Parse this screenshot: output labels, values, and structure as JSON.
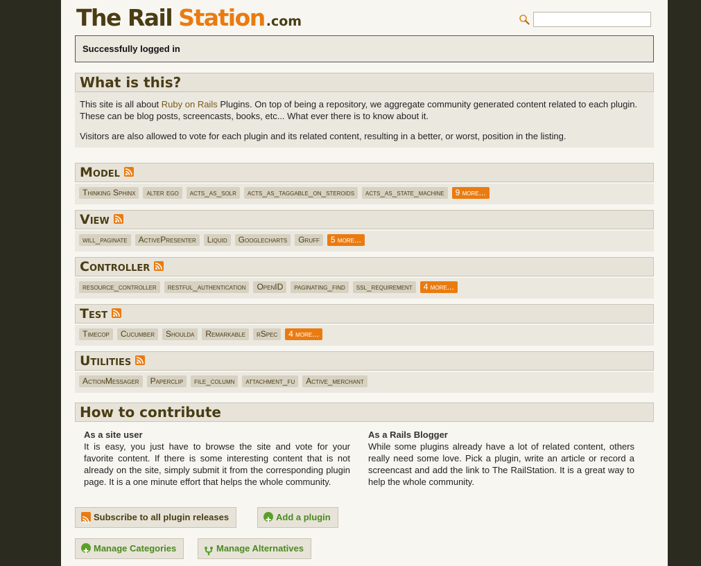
{
  "header": {
    "logo_part1": "The Rail",
    "logo_part2": "Station",
    "logo_part3": ".com",
    "search": {
      "value": "",
      "placeholder": ""
    }
  },
  "flash": "Successfully logged in",
  "intro": {
    "title": "What is this?",
    "p1_before": "This site is all about ",
    "p1_link": "Ruby on Rails",
    "p1_after": " Plugins. On top of being a repository, we aggregate community generated content related to each plugin. These can be blog posts, screencasts, books, etc... What ever there is to know about it.",
    "p2": "Visitors are also allowed to vote for each plugin and its related content, resulting in a better, or worst, position in the listing."
  },
  "categories": [
    {
      "title": "Model",
      "tags": [
        "Thinking Sphinx",
        "alter ego",
        "acts_as_solr",
        "acts_as_taggable_on_steroids",
        "acts_as_state_machine"
      ],
      "more": "9 more..."
    },
    {
      "title": "View",
      "tags": [
        "will_paginate",
        "ActivePresenter",
        "Liquid",
        "Googlecharts",
        "Gruff"
      ],
      "more": "5 more..."
    },
    {
      "title": "Controller",
      "tags": [
        "resource_controller",
        "restful_authentication",
        "OpenID",
        "paginating_find",
        "ssl_requirement"
      ],
      "more": "4 more..."
    },
    {
      "title": "Test",
      "tags": [
        "Timecop",
        "Cucumber",
        "Shoulda",
        "Remarkable",
        "rSpec"
      ],
      "more": "4 more..."
    },
    {
      "title": "Utilities",
      "tags": [
        "ActionMessager",
        "Paperclip",
        "file_column",
        "attachment_fu",
        "Active_merchant"
      ],
      "more": ""
    }
  ],
  "contribute": {
    "title": "How to contribute",
    "user_title": "As a site user",
    "user_text": "It is easy, you just have to browse the site and vote for your favorite content. If there is some interesting content that is not already on the site, simply submit it from the corresponding plugin page. It is a one minute effort that helps the whole community.",
    "blogger_title": "As a Rails Blogger",
    "blogger_text": "While some plugins already have a lot of related content, others really need some love. Pick a plugin, write an article or record a screencast and add the link to The RailStation. It is a great way to help the whole community."
  },
  "buttons": {
    "subscribe": "Subscribe to all plugin releases",
    "add_plugin": "Add a plugin",
    "manage_categories": "Manage Categories",
    "manage_alternatives": "Manage Alternatives"
  },
  "colors": {
    "accent_orange": "#ea7b10",
    "brown_text": "#4a3d14",
    "green_link": "#4b8a1e"
  },
  "icons": {
    "search": "magnifier-icon",
    "rss": "rss-feed-icon",
    "add": "plus-circle-icon",
    "alternatives": "fork-icon"
  }
}
